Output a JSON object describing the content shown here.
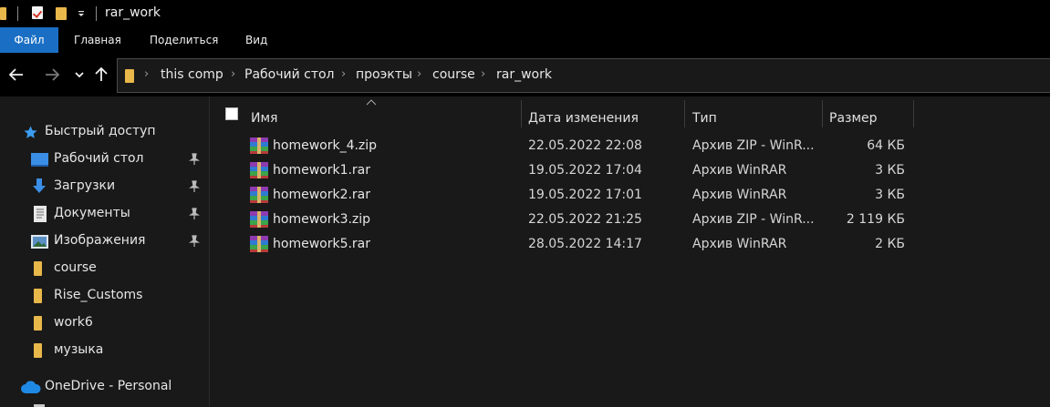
{
  "window": {
    "title": "rar_work"
  },
  "ribbon": {
    "tabs": [
      "Файл",
      "Главная",
      "Поделиться",
      "Вид"
    ]
  },
  "address": {
    "crumbs": [
      "this comp",
      "Рабочий стол",
      "проэкты",
      "course",
      "rar_work"
    ]
  },
  "sidebar": {
    "quick_access": "Быстрый доступ",
    "items": [
      {
        "label": "Рабочий стол",
        "icon": "desktop-icon",
        "pinned": true
      },
      {
        "label": "Загрузки",
        "icon": "download-icon",
        "pinned": true
      },
      {
        "label": "Документы",
        "icon": "document-icon",
        "pinned": true
      },
      {
        "label": "Изображения",
        "icon": "pictures-icon",
        "pinned": true
      },
      {
        "label": "course",
        "icon": "folder-icon",
        "pinned": false
      },
      {
        "label": "Rise_Customs",
        "icon": "folder-icon",
        "pinned": false
      },
      {
        "label": "work6",
        "icon": "folder-icon",
        "pinned": false
      },
      {
        "label": "музыка",
        "icon": "folder-icon",
        "pinned": false
      }
    ],
    "onedrive": "OneDrive - Personal"
  },
  "columns": {
    "name": "Имя",
    "date": "Дата изменения",
    "type": "Тип",
    "size": "Размер"
  },
  "files": [
    {
      "name": "homework_4.zip",
      "date": "22.05.2022 22:08",
      "type": "Архив ZIP - WinR...",
      "size": "64 КБ"
    },
    {
      "name": "homework1.rar",
      "date": "19.05.2022 17:04",
      "type": "Архив WinRAR",
      "size": "3 КБ"
    },
    {
      "name": "homework2.rar",
      "date": "19.05.2022 17:01",
      "type": "Архив WinRAR",
      "size": "3 КБ"
    },
    {
      "name": "homework3.zip",
      "date": "22.05.2022 21:25",
      "type": "Архив ZIP - WinR...",
      "size": "2 119 КБ"
    },
    {
      "name": "homework5.rar",
      "date": "28.05.2022 14:17",
      "type": "Архив WinRAR",
      "size": "2 КБ"
    }
  ],
  "colors": {
    "accent": "#1a6fc4",
    "folder": "#e8b84a",
    "background": "#191919",
    "chrome": "#000000"
  }
}
